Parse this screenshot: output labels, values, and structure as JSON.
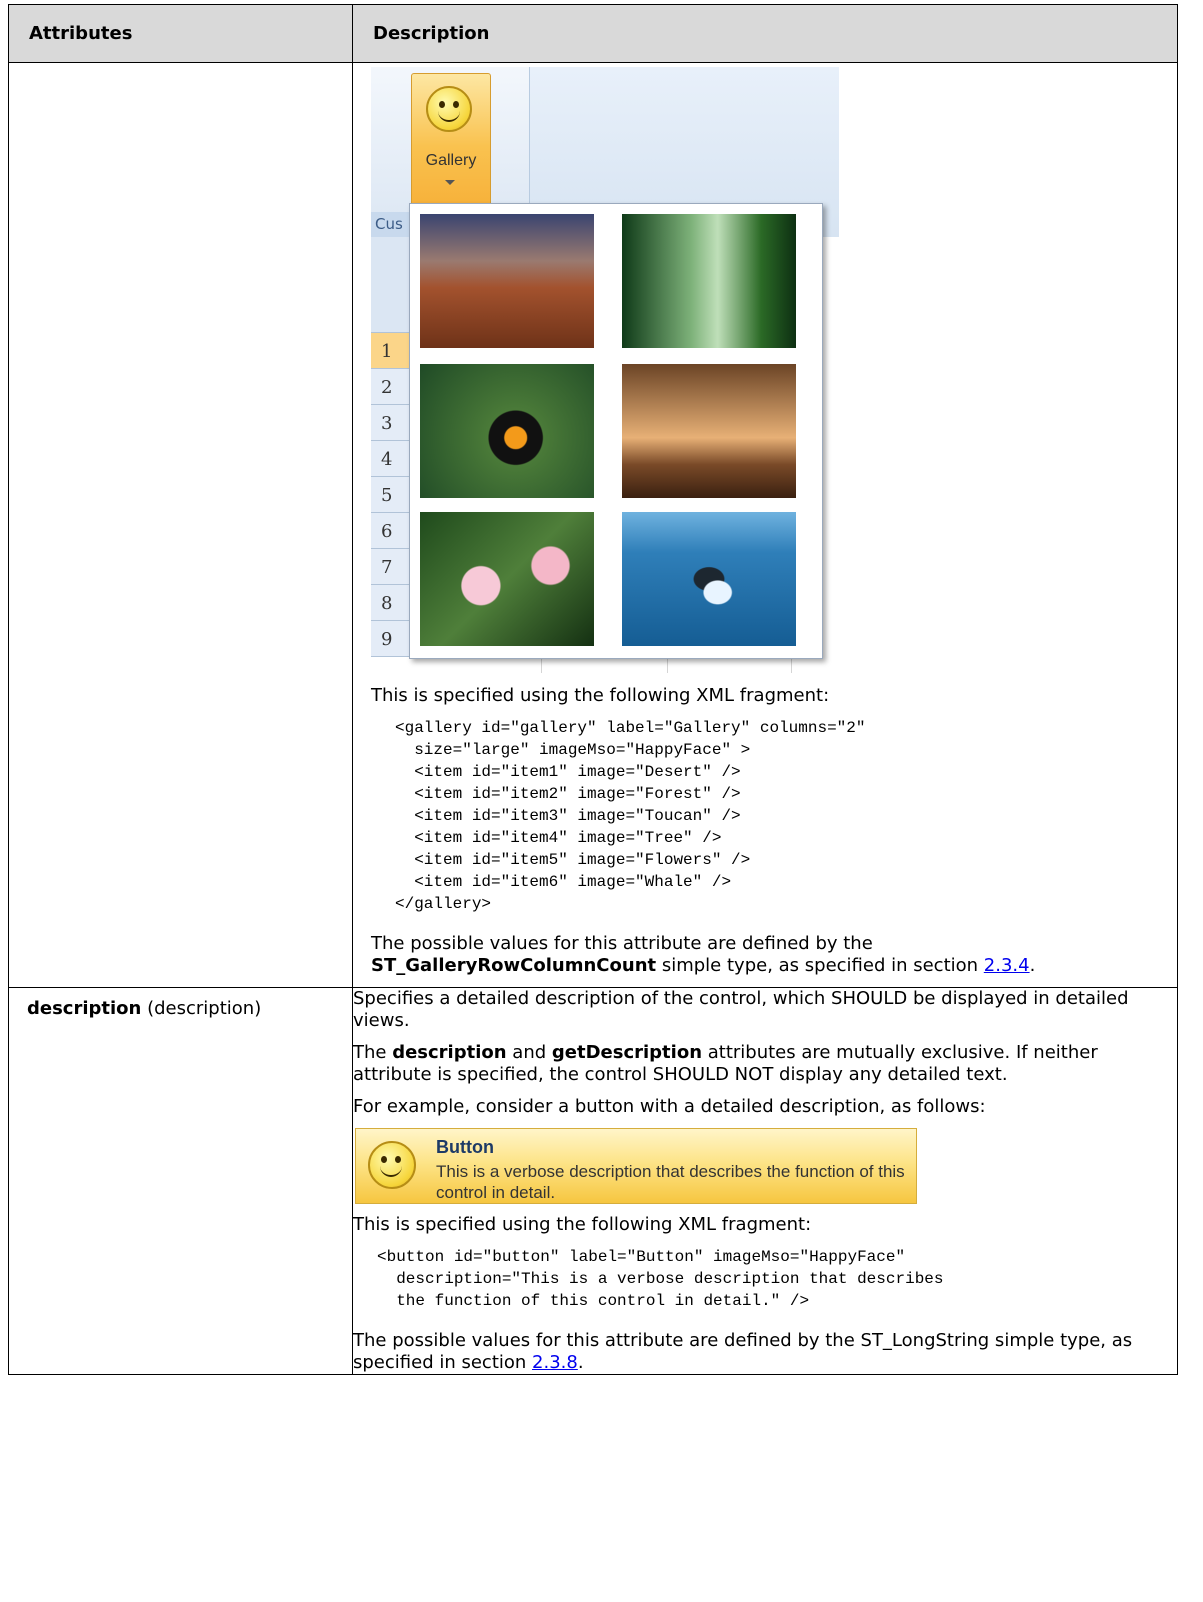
{
  "header": {
    "col1": "Attributes",
    "col2": "Description"
  },
  "gallery_row": {
    "screenshot": {
      "button_label": "Gallery",
      "group_label": "Cus",
      "row_numbers": [
        "1",
        "2",
        "3",
        "4",
        "5",
        "6",
        "7",
        "8",
        "9"
      ],
      "items": [
        "Desert",
        "Forest",
        "Toucan",
        "Tree",
        "Flowers",
        "Whale"
      ]
    },
    "intro": "This is specified using the following XML fragment:",
    "code": "<gallery id=\"gallery\" label=\"Gallery\" columns=\"2\"\n  size=\"large\" imageMso=\"HappyFace\" >\n  <item id=\"item1\" image=\"Desert\" />\n  <item id=\"item2\" image=\"Forest\" />\n  <item id=\"item3\" image=\"Toucan\" />\n  <item id=\"item4\" image=\"Tree\" />\n  <item id=\"item5\" image=\"Flowers\" />\n  <item id=\"item6\" image=\"Whale\" />\n</gallery>",
    "values_pre": "The possible values for this attribute are defined by the",
    "values_type": "ST_GalleryRowColumnCount",
    "values_mid": " simple type, as specified in section ",
    "values_link": "2.3.4",
    "values_end": "."
  },
  "description_row": {
    "attr_name": "description",
    "attr_paren": " (description)",
    "p1": "Specifies a detailed description of the control, which SHOULD be displayed in detailed views.",
    "p2_pre": "The ",
    "p2_b1": "description",
    "p2_mid": " and ",
    "p2_b2": "getDescription",
    "p2_post": " attributes are mutually exclusive. If neither attribute is specified, the control SHOULD NOT display any detailed text.",
    "p3": "For example, consider a button with a detailed description, as follows:",
    "button": {
      "title": "Button",
      "text": "This is a verbose description that describes the function of this control in detail."
    },
    "intro": "This is specified using the following XML fragment:",
    "code": "<button id=\"button\" label=\"Button\" imageMso=\"HappyFace\"\n  description=\"This is a verbose description that describes\n  the function of this control in detail.\" />",
    "values_pre": "The possible values for this attribute are defined by the ST_LongString simple type, as specified in section ",
    "values_link": "2.3.8",
    "values_end": "."
  }
}
